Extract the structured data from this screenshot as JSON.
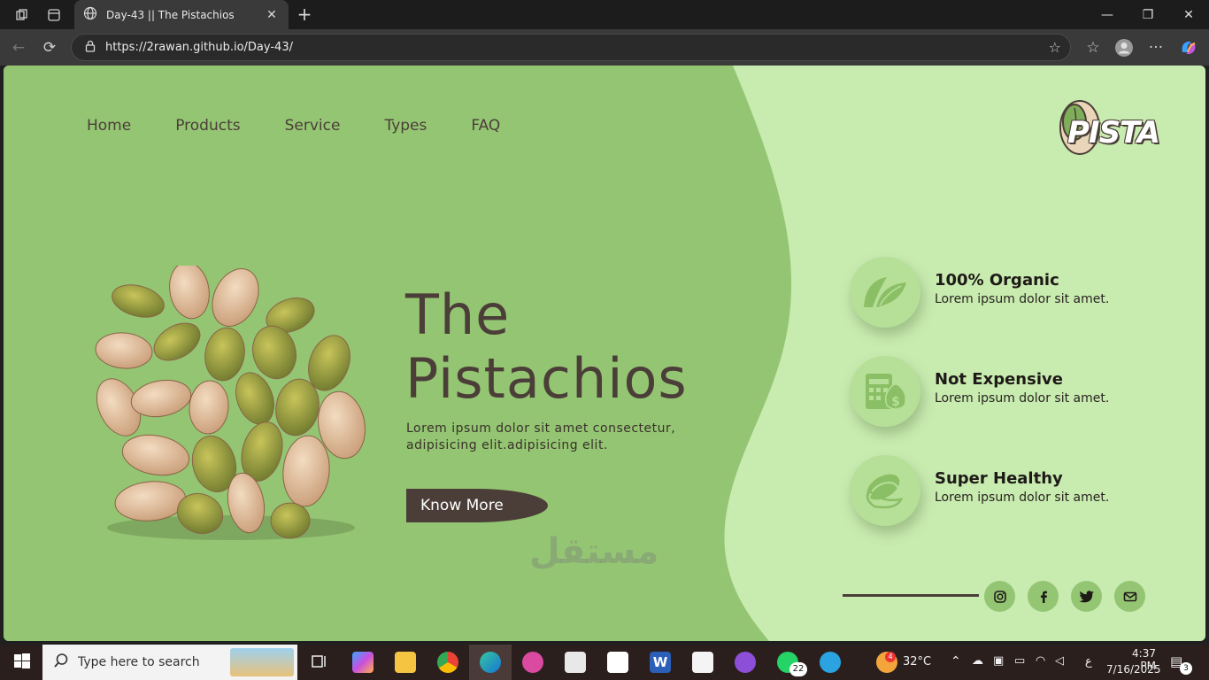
{
  "browser": {
    "tab_title": "Day-43 || The Pistachios",
    "url": "https://2rawan.github.io/Day-43/"
  },
  "page": {
    "nav": [
      "Home",
      "Products",
      "Service",
      "Types",
      "FAQ"
    ],
    "logo_text": "PISTA",
    "hero": {
      "title_line1": "The",
      "title_line2": "Pistachios",
      "description": "Lorem ipsum dolor sit amet consectetur, adipisicing elit.adipisicing elit.",
      "button_label": "Know More"
    },
    "features": [
      {
        "title": "100% Organic",
        "desc": "Lorem ipsum dolor sit amet.",
        "icon": "leaf-icon"
      },
      {
        "title": "Not Expensive",
        "desc": "Lorem ipsum dolor sit amet.",
        "icon": "money-icon"
      },
      {
        "title": "Super Healthy",
        "desc": "Lorem ipsum dolor sit amet.",
        "icon": "nut-icon"
      }
    ],
    "social": [
      "instagram-icon",
      "facebook-icon",
      "twitter-icon",
      "mail-icon"
    ],
    "colors": {
      "primary_green": "#94c573",
      "light_green": "#c8ebb0",
      "dark_brown": "#4b3e38"
    }
  },
  "taskbar": {
    "search_placeholder": "Type here to search",
    "temperature": "32°C",
    "time": "4:37 PM",
    "date": "7/16/2025",
    "whatsapp_badge": "22",
    "notifications": "3",
    "weather_badge": "4",
    "lang": "ع"
  },
  "watermark": "مستقل"
}
